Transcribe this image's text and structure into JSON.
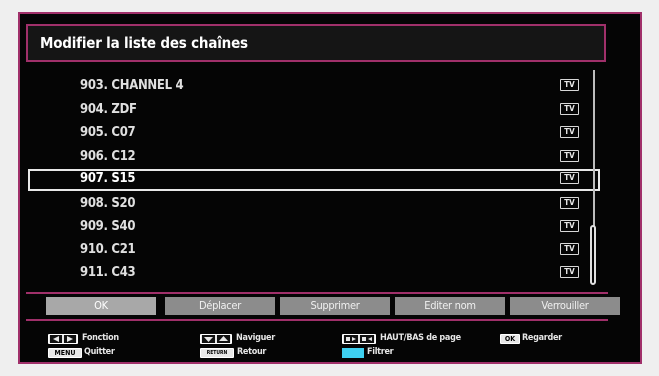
{
  "title": "Modifier la liste des chaînes",
  "channels": [
    {
      "label": "903. CHANNEL 4",
      "badge": "TV"
    },
    {
      "label": "904. ZDF",
      "badge": "TV"
    },
    {
      "label": "905. C07",
      "badge": "TV"
    },
    {
      "label": "906. C12",
      "badge": "TV"
    },
    {
      "label": "907. S15",
      "badge": "TV",
      "selected": true
    },
    {
      "label": "908. S20",
      "badge": "TV"
    },
    {
      "label": "909. S40",
      "badge": "TV"
    },
    {
      "label": "910. C21",
      "badge": "TV"
    },
    {
      "label": "911. C43",
      "badge": "TV"
    }
  ],
  "buttons": {
    "ok": "OK",
    "move": "Déplacer",
    "delete": "Supprimer",
    "edit_name": "Editer nom",
    "lock": "Verrouiller"
  },
  "legend": {
    "function": "Fonction",
    "quit": "Quitter",
    "navigate": "Naviguer",
    "back": "Retour",
    "page": "HAUT/BAS de page",
    "filter": "Filtrer",
    "watch": "Regarder",
    "menu_key": "MENU",
    "ok_key": "OK",
    "return_key": "RETURN"
  },
  "colors": {
    "frame_accent": "#a0306a",
    "background": "#050505",
    "button": "#8c8c8c",
    "filter_key": "#3ed0f0"
  },
  "scrollbar": {
    "position_fraction": 0.75
  }
}
